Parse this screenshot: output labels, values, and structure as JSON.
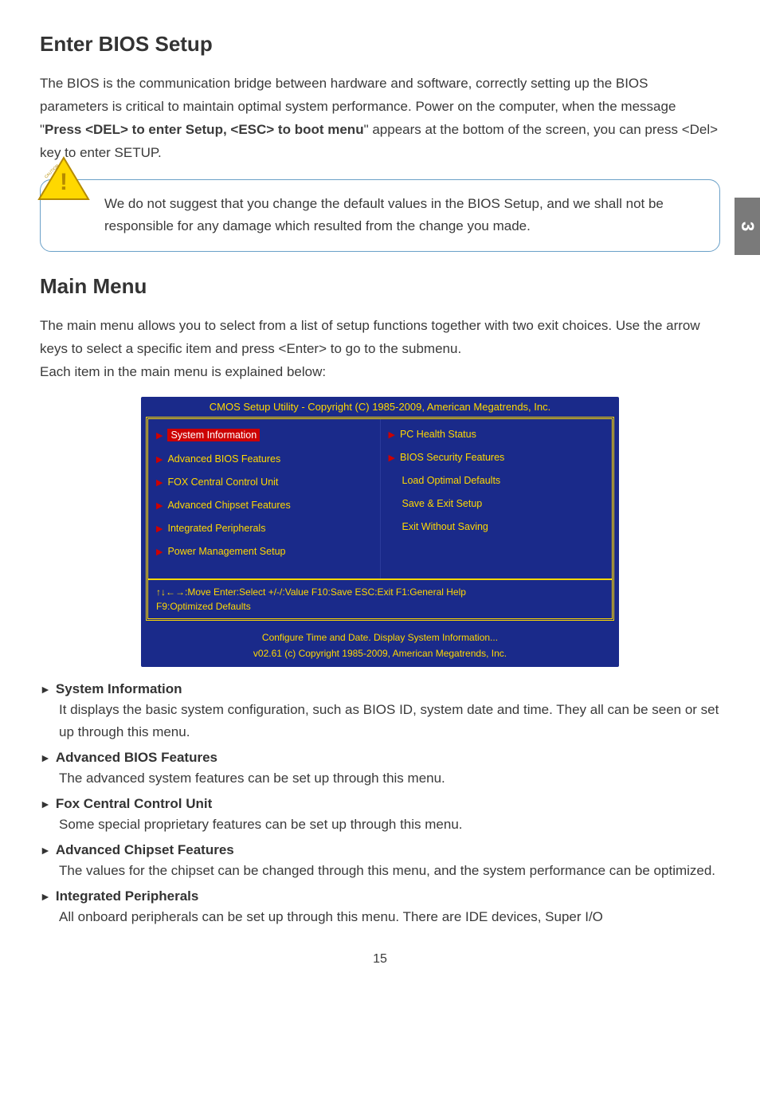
{
  "side_tab": "3",
  "enter_bios": {
    "title": "Enter BIOS Setup",
    "para_parts": {
      "a": "The BIOS is the communication bridge between hardware and software, correctly setting up the BIOS parameters is critical to maintain optimal system performance. Power on the computer, when the message \"",
      "b": "Press <DEL> to enter Setup, <ESC> to boot menu",
      "c": "\" appears at the bottom of the screen, you can press <Del> key to enter SETUP."
    },
    "caution_label": "CAUTION",
    "caution_text": "We do not suggest that you change the default values in the BIOS Setup, and we shall not be responsible for any damage which resulted from the change you made."
  },
  "main_menu": {
    "title": "Main Menu",
    "intro": "The main menu allows you to select from a list of setup functions together with two exit choices. Use the arrow keys to select a specific item and press <Enter> to go to the submenu.\nEach item in the main menu is explained below:"
  },
  "bios_window": {
    "title": "CMOS Setup Utility - Copyright (C) 1985-2009, American Megatrends, Inc.",
    "left_items": [
      "System Information",
      "Advanced BIOS Features",
      "FOX Central Control Unit",
      "Advanced Chipset Features",
      "Integrated Peripherals",
      "Power Management Setup"
    ],
    "right_items": [
      "PC Health Status",
      "BIOS Security Features",
      "Load Optimal Defaults",
      "Save & Exit Setup",
      "Exit Without Saving"
    ],
    "footer": "↑↓←→:Move  Enter:Select    +/-/:Value     F10:Save   ESC:Exit      F1:General Help\nF9:Optimized Defaults",
    "tip": "Configure Time and Date.  Display System Information...",
    "copyright": "v02.61   (c) Copyright 1985-2009, American Megatrends, Inc."
  },
  "descriptions": [
    {
      "title": "System Information",
      "body": "It displays the basic system configuration, such as BIOS ID, system date and time. They all can be seen or set up through this menu."
    },
    {
      "title": "Advanced BIOS Features",
      "body": "The advanced system features can be set up through this menu."
    },
    {
      "title": "Fox Central Control Unit",
      "body": "Some special proprietary features can be set up through this menu."
    },
    {
      "title": "Advanced Chipset Features",
      "body": "The values for the chipset can be changed through this menu, and the system performance can be optimized."
    },
    {
      "title": "Integrated Peripherals",
      "body": "All onboard peripherals can be set up through this menu. There are IDE devices, Super I/O"
    }
  ],
  "page_number": "15"
}
